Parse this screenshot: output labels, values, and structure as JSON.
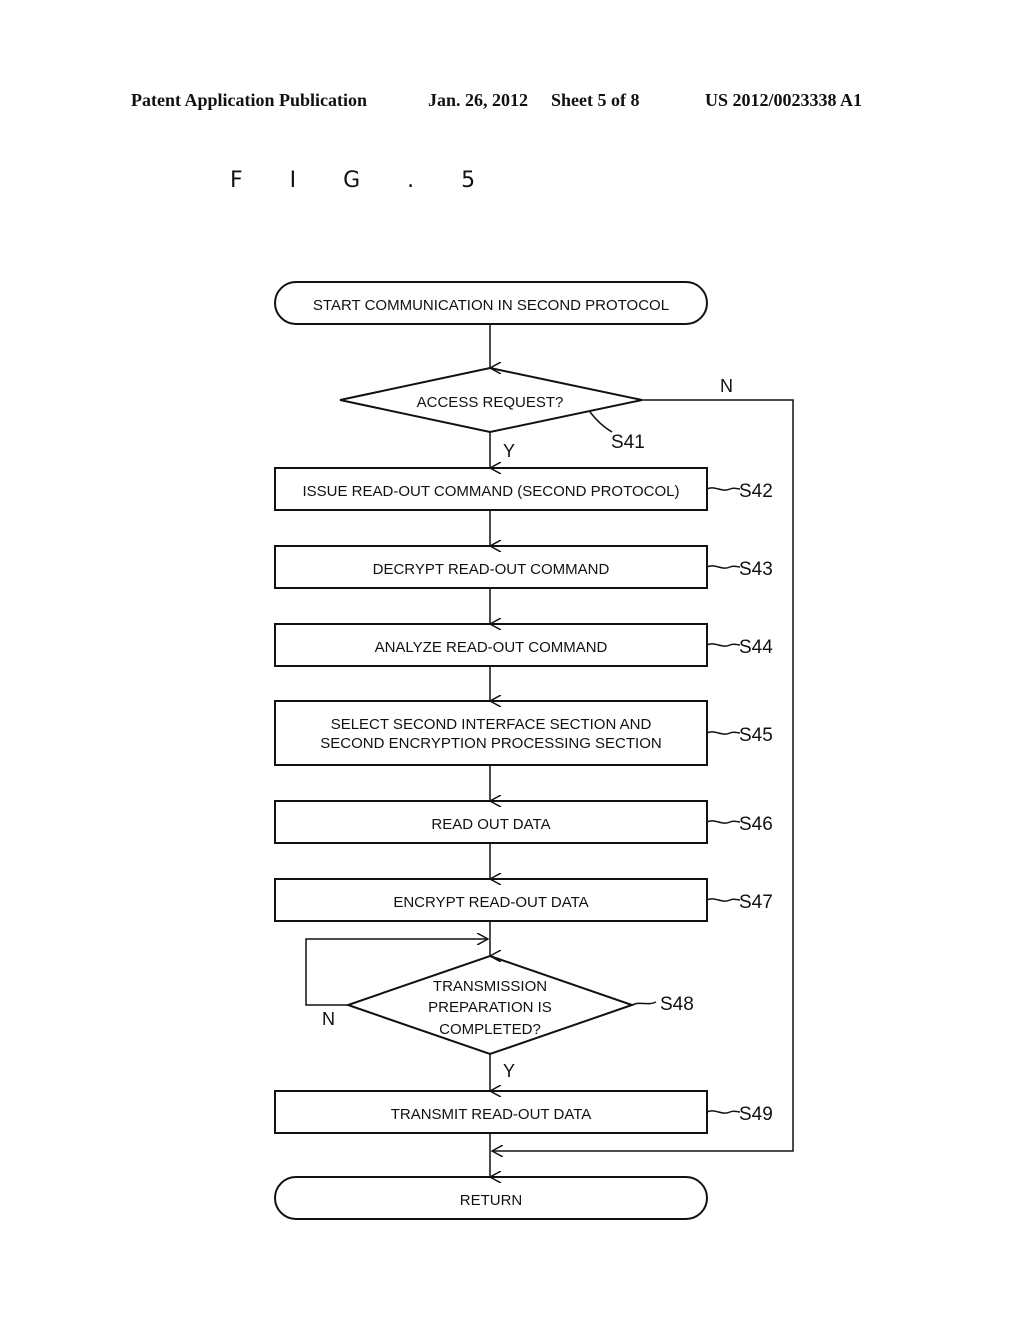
{
  "header": {
    "publication": "Patent Application Publication",
    "date": "Jan. 26, 2012",
    "sheet": "Sheet 5 of 8",
    "number": "US 2012/0023338 A1"
  },
  "figure": {
    "label": "F I G . 5"
  },
  "flowchart": {
    "start": "START COMMUNICATION IN SECOND PROTOCOL",
    "s41": {
      "label": "S41",
      "text": "ACCESS REQUEST?",
      "yes": "Y",
      "no": "N"
    },
    "s42": {
      "label": "S42",
      "text": "ISSUE READ-OUT COMMAND (SECOND PROTOCOL)"
    },
    "s43": {
      "label": "S43",
      "text": "DECRYPT READ-OUT COMMAND"
    },
    "s44": {
      "label": "S44",
      "text": "ANALYZE READ-OUT COMMAND"
    },
    "s45": {
      "label": "S45",
      "line1": "SELECT SECOND INTERFACE SECTION AND",
      "line2": "SECOND ENCRYPTION PROCESSING SECTION"
    },
    "s46": {
      "label": "S46",
      "text": "READ OUT DATA"
    },
    "s47": {
      "label": "S47",
      "text": "ENCRYPT READ-OUT DATA"
    },
    "s48": {
      "label": "S48",
      "line1": "TRANSMISSION",
      "line2": "PREPARATION IS",
      "line3": "COMPLETED?",
      "yes": "Y",
      "no": "N"
    },
    "s49": {
      "label": "S49",
      "text": "TRANSMIT READ-OUT DATA"
    },
    "end": "RETURN"
  }
}
